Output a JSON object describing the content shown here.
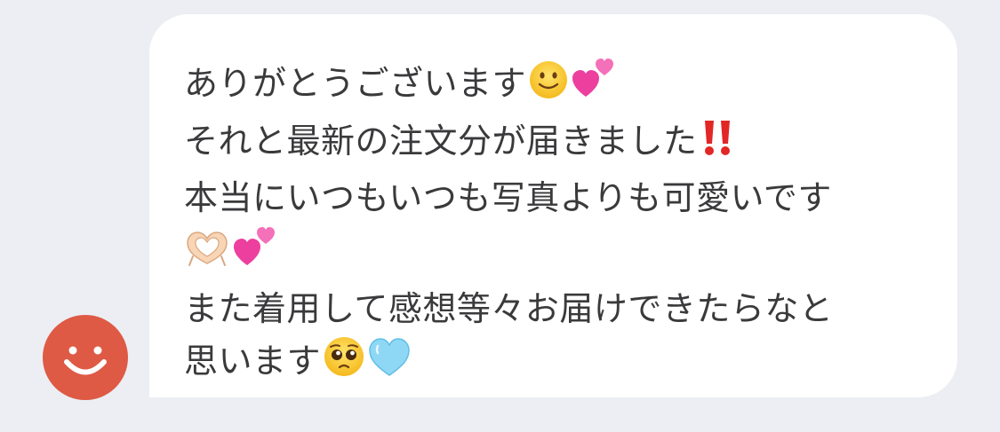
{
  "message": {
    "lines": [
      "ありがとうございます",
      "それと最新の注文分が届きました",
      "本当にいつもいつも写真よりも可愛いです",
      "",
      "また着用して感想等々お届けできたらなと",
      "思います"
    ]
  },
  "icons": {
    "avatar": "smiley-avatar-icon",
    "emoji_line1": [
      "slightly-smiling-face-icon",
      "two-hearts-icon"
    ],
    "emoji_line2": [
      "double-exclamation-icon"
    ],
    "emoji_line4": [
      "heart-hands-icon",
      "two-hearts-icon"
    ],
    "emoji_line6": [
      "pleading-face-icon",
      "light-blue-heart-icon"
    ]
  },
  "colors": {
    "background": "#eceef3",
    "bubble": "#ffffff",
    "text": "#3a3a3c",
    "avatar": "#de5a44"
  }
}
